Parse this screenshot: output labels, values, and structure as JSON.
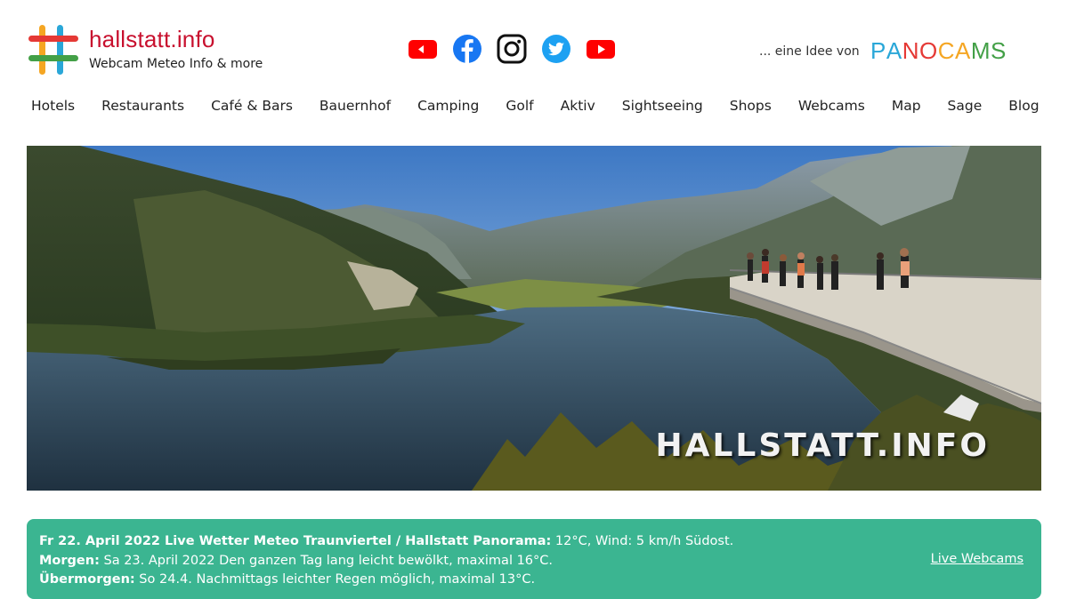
{
  "brand": {
    "title": "hallstatt.info",
    "subtitle": "Webcam Meteo Info & more"
  },
  "social": [
    {
      "name": "youtube-small-icon"
    },
    {
      "name": "facebook-icon"
    },
    {
      "name": "instagram-icon"
    },
    {
      "name": "twitter-icon"
    },
    {
      "name": "youtube-icon"
    }
  ],
  "idea": {
    "prefix": "... eine Idee von",
    "brand_letters": [
      {
        "ch": "P",
        "color": "#2aa7d8"
      },
      {
        "ch": "A",
        "color": "#2aa7d8"
      },
      {
        "ch": "N",
        "color": "#e53935"
      },
      {
        "ch": "O",
        "color": "#e53935"
      },
      {
        "ch": "C",
        "color": "#f5a623"
      },
      {
        "ch": "A",
        "color": "#f5a623"
      },
      {
        "ch": "M",
        "color": "#43a047"
      },
      {
        "ch": "S",
        "color": "#43a047"
      }
    ]
  },
  "nav": [
    "Hotels",
    "Restaurants",
    "Café & Bars",
    "Bauernhof",
    "Camping",
    "Golf",
    "Aktiv",
    "Sightseeing",
    "Shops",
    "Webcams",
    "Map",
    "Sage",
    "Blog"
  ],
  "hero": {
    "caption": "HALLSTATT.INFO"
  },
  "weather": {
    "today_label": "Fr 22. April 2022 Live Wetter Meteo Traunviertel / Hallstatt Panorama:",
    "today_text": " 12°C, Wind: 5 km/h Südost.",
    "tomorrow_label": "Morgen:",
    "tomorrow_text": " Sa 23. April 2022 Den ganzen Tag lang leicht bewölkt, maximal 16°C.",
    "dayafter_label": "Übermorgen:",
    "dayafter_text": " So 24.4. Nachmittags leichter Regen möglich, maximal 13°C.",
    "live_link": "Live Webcams"
  },
  "colors": {
    "brand_red": "#c8102e",
    "weather_bg": "#3bb591"
  }
}
